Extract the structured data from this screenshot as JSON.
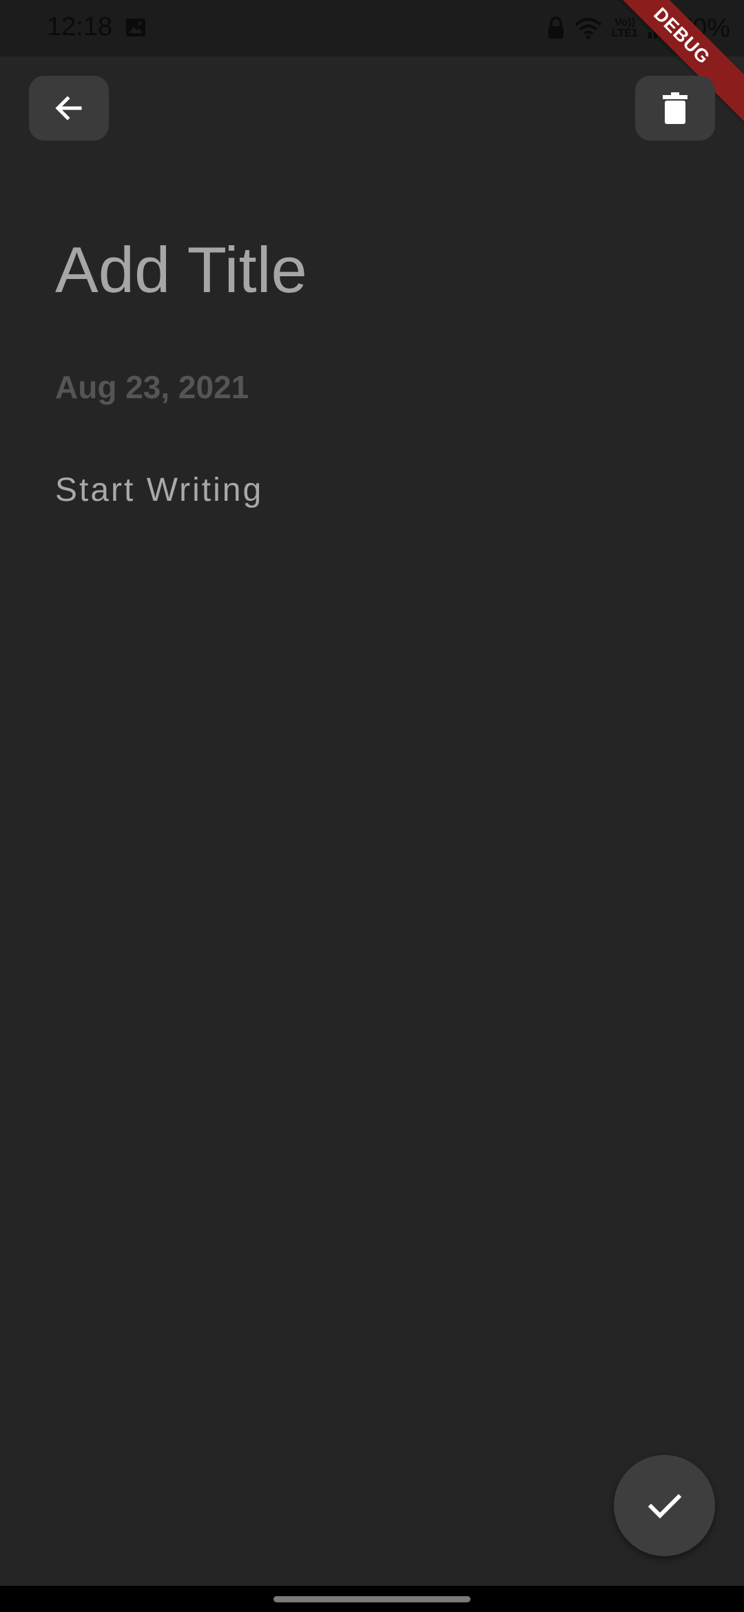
{
  "status_bar": {
    "time": "12:18",
    "battery": "70%",
    "network_label_top": "Vo))",
    "network_label_bottom": "LTE1",
    "icons": [
      "gallery-icon",
      "lock-icon",
      "wifi-icon",
      "volte-icon",
      "signal-icon"
    ]
  },
  "debug_banner": {
    "label": "DEBUG",
    "color": "#8c1d1d"
  },
  "toolbar": {
    "back_icon": "arrow-back-icon",
    "delete_icon": "trash-icon"
  },
  "note": {
    "title_placeholder": "Add Title",
    "date": "Aug 23, 2021",
    "body_placeholder": "Start Writing"
  },
  "fab": {
    "icon": "check-icon"
  },
  "colors": {
    "background": "#252525",
    "button_bg": "#3b3b3b",
    "title_text": "#a6a6a6",
    "date_text": "#555555",
    "body_text": "#a9a9a9"
  }
}
